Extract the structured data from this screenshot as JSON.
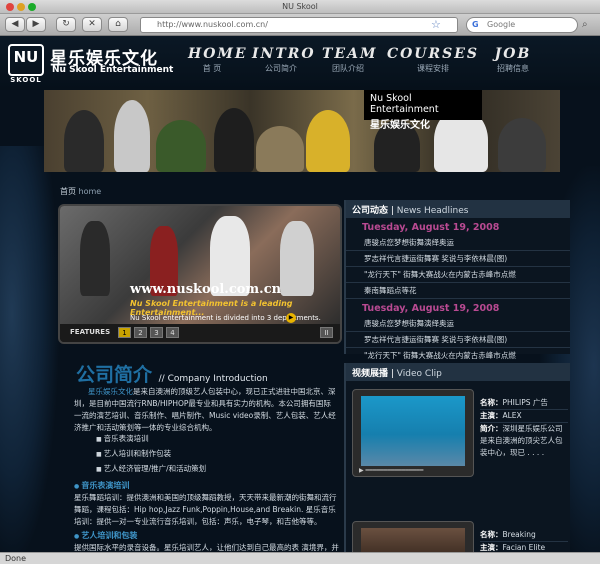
{
  "browser": {
    "window_title": "NU Skool",
    "url": "http://www.nuskool.com.cn/",
    "search_placeholder": "Google",
    "status": "Done"
  },
  "header": {
    "logo_mark": "NU",
    "logo_mark_sub": "SKOOL",
    "logo_cn": "星乐娱乐文化",
    "logo_en": "Nu Skool Entertainment",
    "nav": [
      {
        "en": "HOME",
        "cn": "首 页"
      },
      {
        "en": "INTRO",
        "cn": "公司简介"
      },
      {
        "en": "TEAM",
        "cn": "团队介绍"
      },
      {
        "en": "COURSES",
        "cn": "课程安排"
      },
      {
        "en": "JOB",
        "cn": "招聘信息"
      }
    ]
  },
  "banner": {
    "tag_en": "Nu Skool Entertainment",
    "tag_cn": "星乐娱乐文化"
  },
  "breadcrumb": {
    "cn": "首页",
    "en": "home"
  },
  "slideshow": {
    "url": "www.nuskool.com.cn",
    "desc": "Nu Skool Entertainment is a leading Entertainment...",
    "sub": "Nu Skool entertainment is divided into 3 departments.",
    "features_label": "FEATURES",
    "pages": [
      "1",
      "2",
      "3",
      "4"
    ],
    "next": "II"
  },
  "news": {
    "title_cn": "公司动态",
    "title_en": "News Headlines",
    "groups": [
      {
        "date": "Tuesday, August 19, 2008",
        "items": [
          "唐骏点您梦想街舞演绎奥运",
          "罗志祥代言捷运街舞赛 奖说与李依林晨(图)",
          "\"龙行天下\" 街舞大赛战火在内蒙古赤峰市点燃",
          "秦南舞蹈点等花"
        ]
      },
      {
        "date": "Tuesday, August 19, 2008",
        "items": [
          "唐骏点您梦想街舞演绎奥运",
          "罗志祥代言捷运街舞赛 奖说与李依林晨(图)",
          "\"龙行天下\" 街舞大赛战火在内蒙古赤峰市点燃"
        ]
      }
    ]
  },
  "video": {
    "title_cn": "视频展播",
    "title_en": "Video Clip",
    "clips": [
      {
        "name_label": "名称：",
        "name": "PHILIPS 广告",
        "host_label": "主演：",
        "host": "ALEX",
        "intro_label": "简介：",
        "intro": "深圳星乐娱乐公司是来自澳洲的顶尖艺人包装中心，现已 . . . ."
      },
      {
        "name_label": "名称：",
        "name": "Breaking",
        "host_label": "主演：",
        "host": "Facian Elite"
      }
    ]
  },
  "intro": {
    "title_cn": "公司简介",
    "title_en": "// Company Introduction",
    "highlight": "星乐娱乐文化",
    "text": "是来自澳洲的顶级艺人包装中心，现已正式进驻中国北京、深圳，是目前中国流行RNB/HIPHOP最专业和具有实力的机构。本公司拥有国际一流的演艺培训、音乐制作、唱片制作、Music video录制、艺人包装、艺人经济推广和活动策划等一体的专业综合机构。",
    "bullets": [
      "音乐表演培训",
      "艺人培训和制作包装",
      "艺人经济管理/推广/和活动策划"
    ],
    "sections": [
      {
        "title": "音乐表演培训",
        "text": "星乐舞蹈培训：提供澳洲和美国的顶级舞蹈教授，天天带来最新潮的街舞和流行舞蹈，课程包括：Hip hop,Jazz Funk,Poppin,House,and Breakin. 星乐音乐培训：提供一对一专业流行音乐培训，包括：声乐，电子琴，和吉他等等。"
      },
      {
        "title": "艺人培训和包装",
        "text": "提供国际水平的录音设备。星乐培训艺人，让他们达到自己最高的表 演境界，并且"
      }
    ]
  },
  "colors": {
    "accent_blue": "#3f95c8",
    "date_magenta": "#b94a92",
    "page_bg": "#07111c"
  }
}
